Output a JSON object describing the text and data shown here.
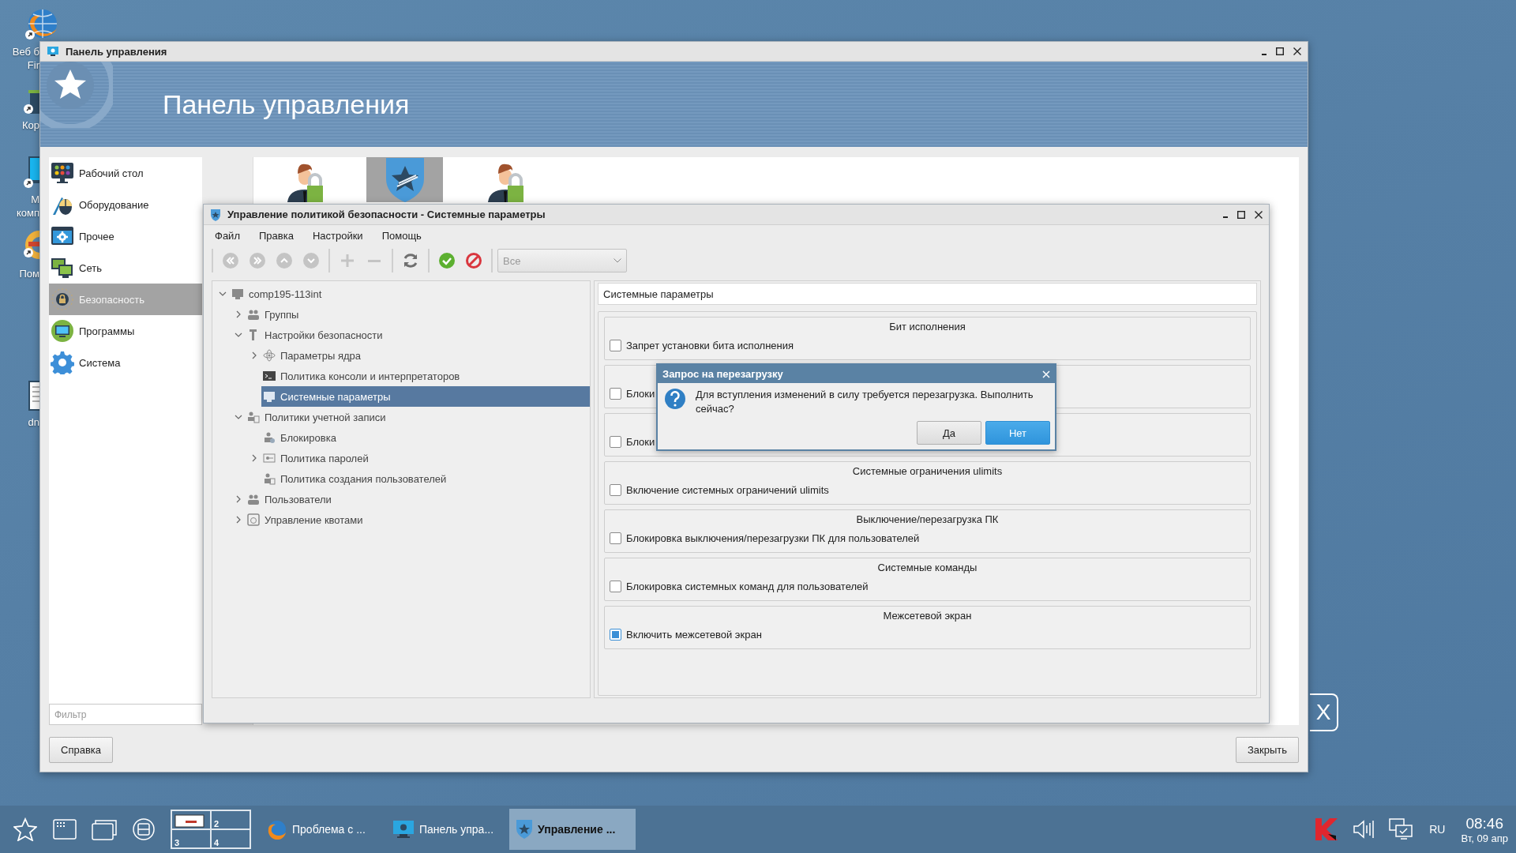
{
  "desktop": {
    "icons": [
      {
        "kind": "browser",
        "lines": [
          "Веб б",
          "Fir"
        ]
      },
      {
        "kind": "trash",
        "lines": [
          "Кор"
        ]
      },
      {
        "kind": "computer",
        "lines": [
          "М",
          "комп"
        ]
      },
      {
        "kind": "help",
        "lines": [
          "Пом"
        ]
      },
      {
        "kind": "document",
        "lines": [
          "dn"
        ]
      }
    ],
    "logo": "X"
  },
  "control_panel": {
    "title": "Панель управления",
    "banner_title": "Панель управления",
    "categories": [
      {
        "kind": "desktop",
        "label": "Рабочий стол",
        "selected": false
      },
      {
        "kind": "hardware",
        "label": "Оборудование",
        "selected": false
      },
      {
        "kind": "other",
        "label": "Прочее",
        "selected": false
      },
      {
        "kind": "network",
        "label": "Сеть",
        "selected": false
      },
      {
        "kind": "security",
        "label": "Безопасность",
        "selected": true
      },
      {
        "kind": "programs",
        "label": "Программы",
        "selected": false
      },
      {
        "kind": "system",
        "label": "Система",
        "selected": false
      }
    ],
    "modules": [
      {
        "kind": "user-lock",
        "selected": false
      },
      {
        "kind": "shield",
        "selected": true
      },
      {
        "kind": "user-lock",
        "selected": false
      }
    ],
    "filter": {
      "placeholder": "Фильтр"
    },
    "buttons": [
      "Справка",
      "Закрыть"
    ]
  },
  "policy_window": {
    "title": "Управление политикой безопасности - Системные параметры",
    "menu": [
      "Файл",
      "Правка",
      "Настройки",
      "Помощь"
    ],
    "toolbar": [
      {
        "buttons": [
          {
            "kind": "first",
            "disabled": true
          },
          {
            "kind": "last",
            "disabled": true
          },
          {
            "kind": "up",
            "disabled": true
          },
          {
            "kind": "down",
            "disabled": true
          }
        ]
      },
      {
        "buttons": [
          {
            "kind": "add",
            "disabled": true
          },
          {
            "kind": "remove",
            "disabled": true
          }
        ]
      },
      {
        "buttons": [
          {
            "kind": "refresh",
            "disabled": false
          }
        ]
      },
      {
        "buttons": [
          {
            "kind": "apply",
            "disabled": false
          },
          {
            "kind": "cancel",
            "disabled": false
          }
        ]
      }
    ],
    "scope_combo": {
      "value": "Все",
      "disabled": true
    },
    "tree": [
      {
        "label": "comp195-113int",
        "kind": "computer",
        "selected": false,
        "expanded": true,
        "children": [
          {
            "label": "Группы",
            "kind": "group",
            "selected": false,
            "expanded": false
          },
          {
            "label": "Настройки безопасности",
            "kind": "tools",
            "selected": false,
            "expanded": true,
            "children": [
              {
                "label": "Параметры ядра",
                "kind": "atom",
                "selected": false,
                "expanded": false
              },
              {
                "label": "Политика консоли и интерпретаторов",
                "kind": "terminal",
                "selected": false
              },
              {
                "label": "Системные параметры",
                "kind": "monitor",
                "selected": true
              }
            ]
          },
          {
            "label": "Политики учетной записи",
            "kind": "account",
            "selected": false,
            "expanded": true,
            "children": [
              {
                "label": "Блокировка",
                "kind": "lock",
                "selected": false
              },
              {
                "label": "Политика паролей",
                "kind": "password",
                "selected": false,
                "expanded": false
              },
              {
                "label": "Политика создания пользователей",
                "kind": "user-add",
                "selected": false
              }
            ]
          },
          {
            "label": "Пользователи",
            "kind": "users",
            "selected": false,
            "expanded": false
          },
          {
            "label": "Управление квотами",
            "kind": "quota",
            "selected": false,
            "expanded": false
          }
        ]
      }
    ],
    "panel_title": "Системные параметры",
    "sections": [
      {
        "title": "Бит исполнения",
        "option": {
          "label": "Запрет установки бита исполнения",
          "checked": false
        }
      },
      {
        "option": {
          "label": "Блоки",
          "checked": false
        }
      },
      {
        "option": {
          "label": "Блоки",
          "checked": false
        }
      },
      {
        "title": "Системные ограничения ulimits",
        "option": {
          "label": "Включение системных ограничений ulimits",
          "checked": false
        }
      },
      {
        "title": "Выключение/перезагрузка ПК",
        "option": {
          "label": "Блокировка выключения/перезагрузки ПК для пользователей",
          "checked": false
        }
      },
      {
        "title": "Системные команды",
        "option": {
          "label": "Блокировка системных команд для пользователей",
          "checked": false
        }
      },
      {
        "title": "Межсетевой экран",
        "option": {
          "label": "Включить межсетевой экран",
          "checked": true
        }
      }
    ]
  },
  "dialog": {
    "title": "Запрос на перезагрузку",
    "message": "Для вступления изменений в силу требуется перезагрузка. Выполнить сейчас?",
    "buttons": [
      {
        "label": "Да",
        "selected": false
      },
      {
        "label": "Нет",
        "selected": true
      }
    ]
  },
  "taskbar": {
    "pager": [
      {
        "kind": "thumbnail"
      },
      {
        "kind": "number",
        "label": "2"
      },
      {
        "kind": "number",
        "label": "3"
      },
      {
        "kind": "number",
        "label": "4"
      }
    ],
    "tasks": [
      {
        "kind": "browser",
        "label": "Проблема с ...",
        "selected": false
      },
      {
        "kind": "panel",
        "label": "Панель упра...",
        "selected": false
      },
      {
        "kind": "shield",
        "label": "Управление ...",
        "selected": true
      }
    ],
    "language": "RU",
    "time": "08:46",
    "date": "Вт, 09 апр"
  }
}
